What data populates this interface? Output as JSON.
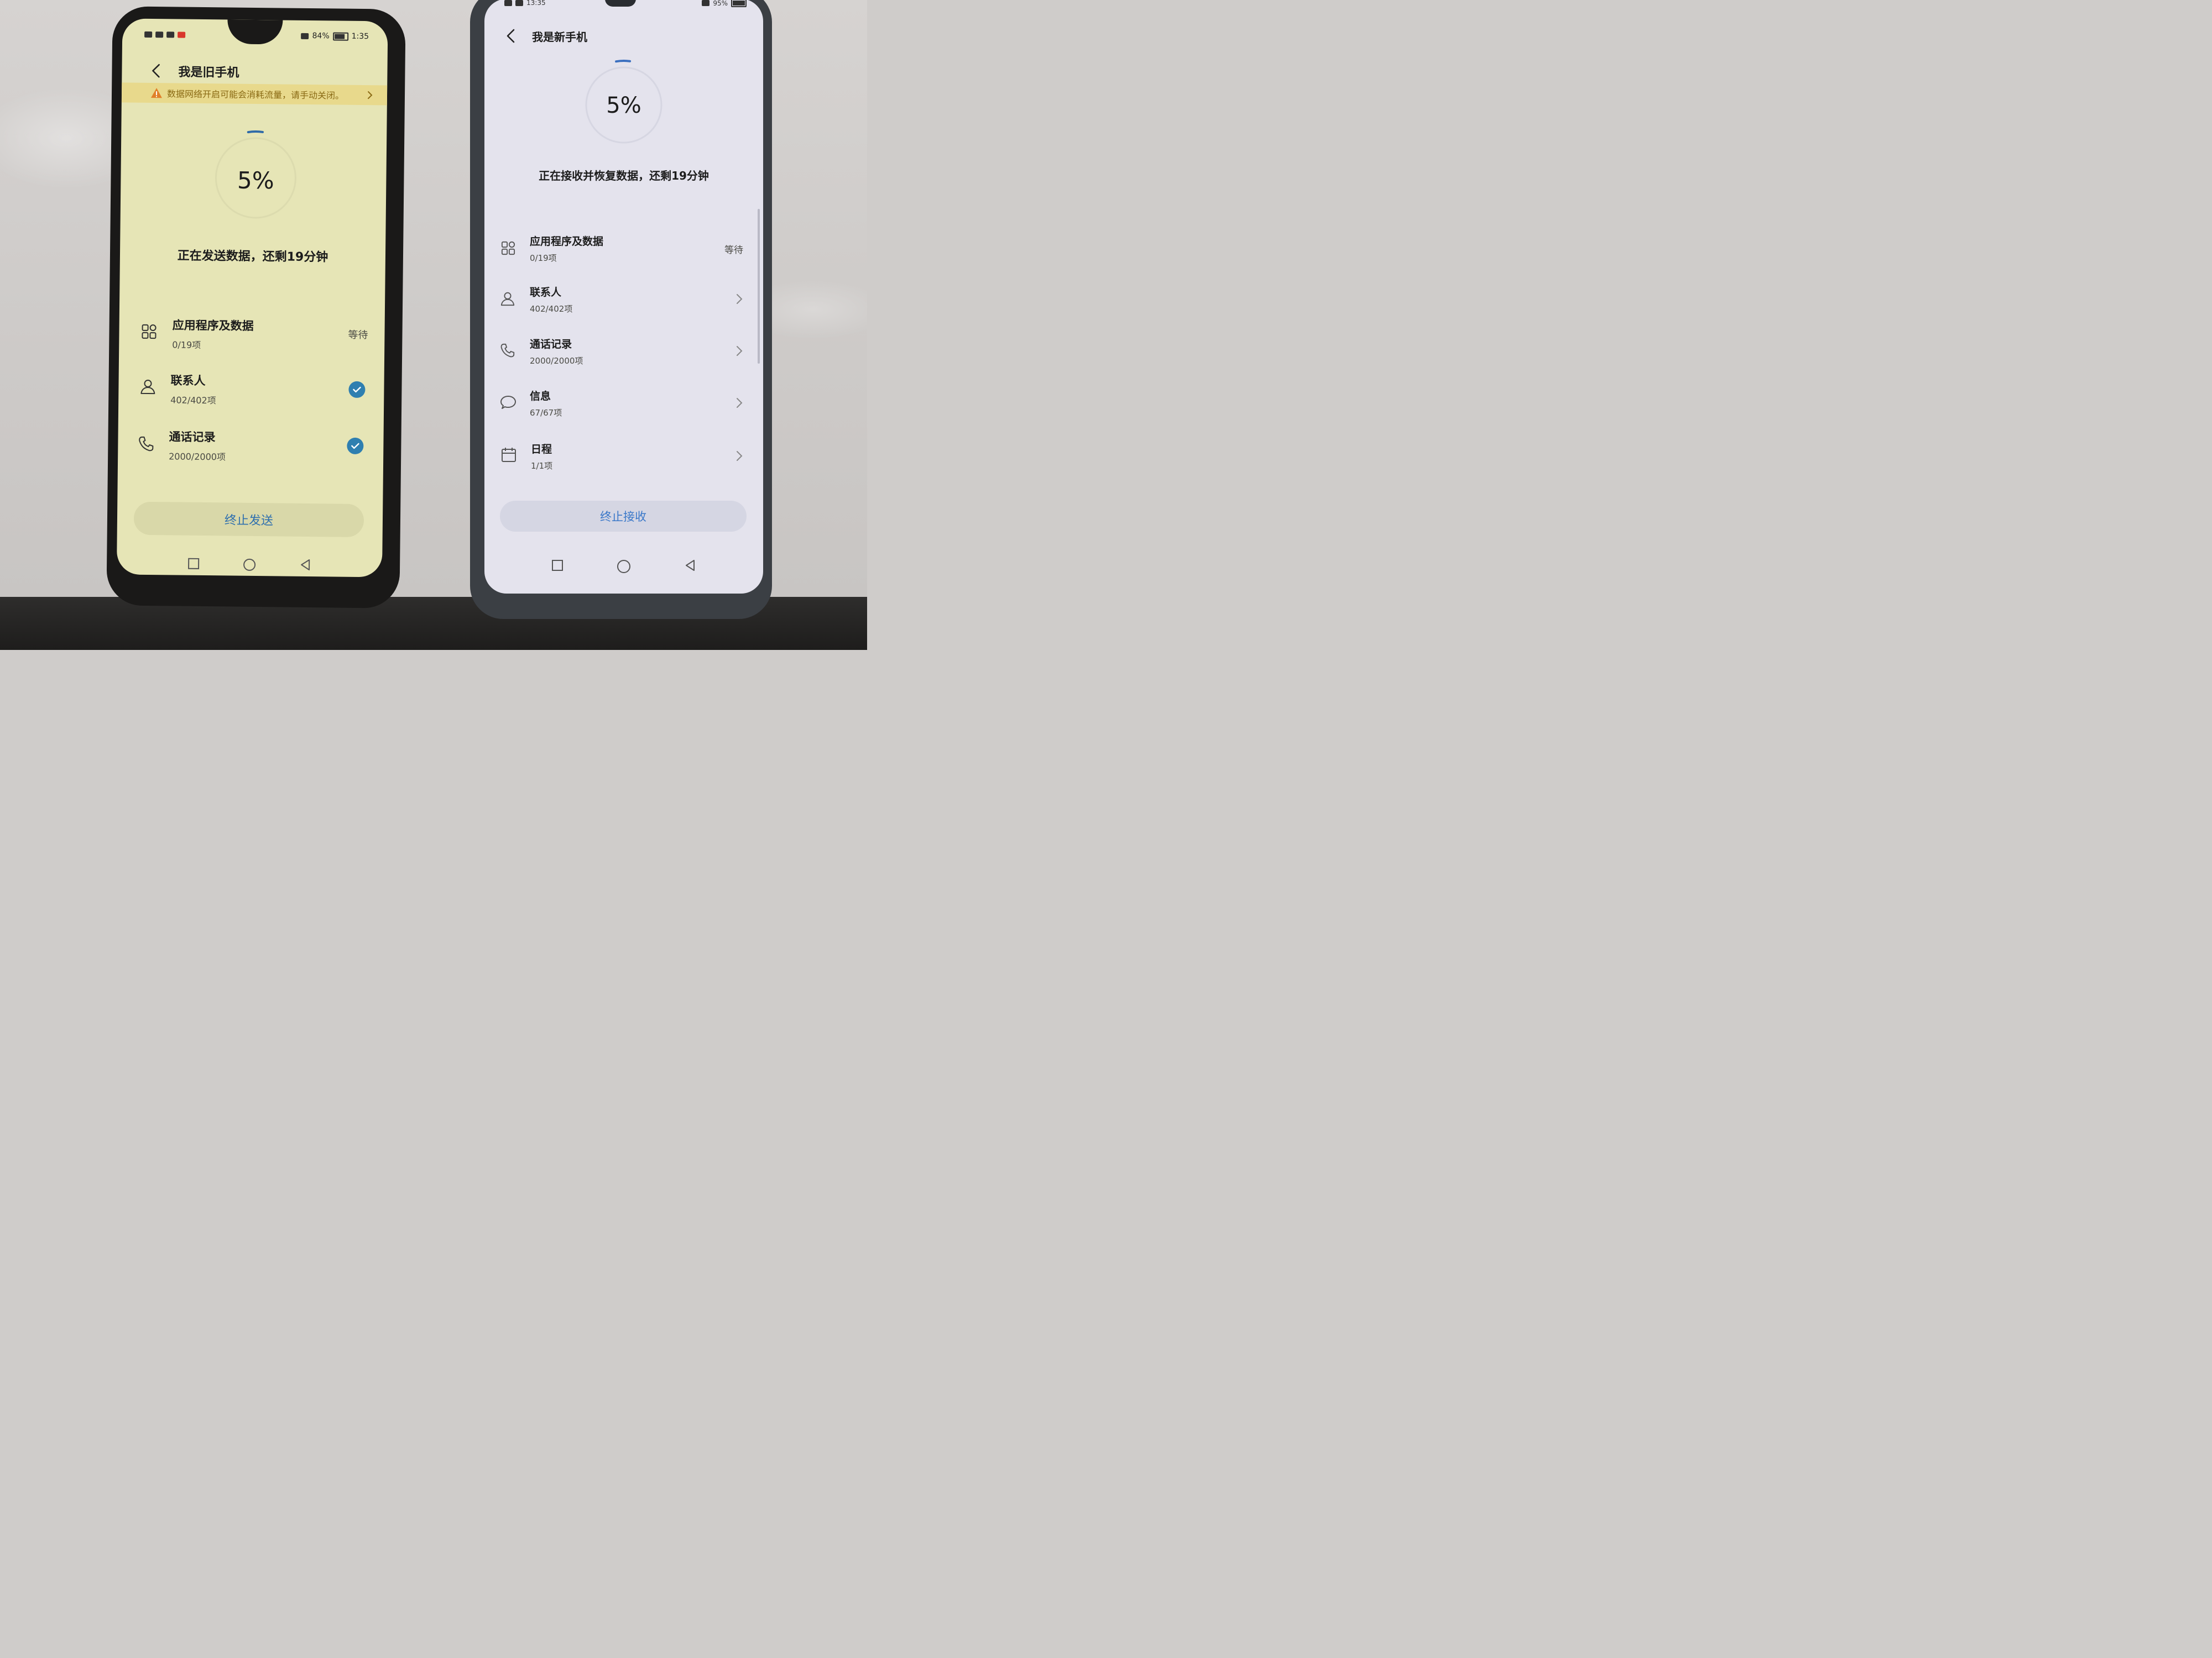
{
  "old_phone": {
    "status": {
      "battery": "84%",
      "time": "1:35"
    },
    "title": "我是旧手机",
    "warning": "数据网络开启可能会消耗流量，请手动关闭。",
    "progress_text": "5%",
    "progress_fraction": 0.05,
    "status_line": "正在发送数据，还剩19分钟",
    "items": [
      {
        "icon": "apps-grid-icon",
        "title": "应用程序及数据",
        "sub": "0/19项",
        "right": "等待"
      },
      {
        "icon": "contact-person-icon",
        "title": "联系人",
        "sub": "402/402项",
        "right": "done"
      },
      {
        "icon": "phone-call-icon",
        "title": "通话记录",
        "sub": "2000/2000项",
        "right": "done"
      }
    ],
    "stop_button": "终止发送",
    "accent": "#2f7fb0"
  },
  "new_phone": {
    "status": {
      "time": "13:35",
      "battery": "95%"
    },
    "title": "我是新手机",
    "progress_text": "5%",
    "progress_fraction": 0.05,
    "status_line": "正在接收并恢复数据，还剩19分钟",
    "items": [
      {
        "icon": "apps-grid-icon",
        "title": "应用程序及数据",
        "sub": "0/19项",
        "right": "等待"
      },
      {
        "icon": "contact-person-icon",
        "title": "联系人",
        "sub": "402/402项",
        "right": "chevron"
      },
      {
        "icon": "phone-call-icon",
        "title": "通话记录",
        "sub": "2000/2000项",
        "right": "chevron"
      },
      {
        "icon": "message-bubble-icon",
        "title": "信息",
        "sub": "67/67项",
        "right": "chevron"
      },
      {
        "icon": "calendar-icon",
        "title": "日程",
        "sub": "1/1项",
        "right": "chevron"
      }
    ],
    "stop_button": "终止接收",
    "accent": "#3a78c9"
  }
}
